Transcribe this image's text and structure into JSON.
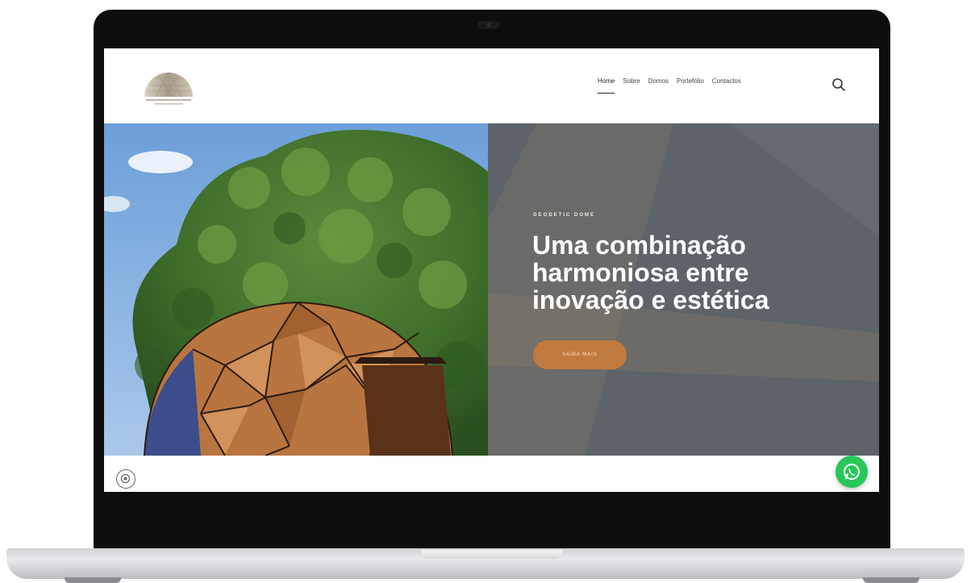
{
  "header": {
    "nav": [
      {
        "label": "Home",
        "active": true
      },
      {
        "label": "Sobre",
        "active": false
      },
      {
        "label": "Domos",
        "active": false
      },
      {
        "label": "Portefólio",
        "active": false
      },
      {
        "label": "Contactos",
        "active": false
      }
    ],
    "search_icon": "search-icon"
  },
  "hero": {
    "eyebrow": "GEODETIC DOME",
    "headline": "Uma combinação harmoniosa entre inovação e estética",
    "cta_label": "SAIBA MAIS"
  },
  "icons": {
    "settings": "settings-icon",
    "chat": "whatsapp-icon"
  },
  "colors": {
    "accent": "#c17a3d",
    "chat_green": "#28c75a",
    "hero_overlay": "#5a5f64"
  }
}
